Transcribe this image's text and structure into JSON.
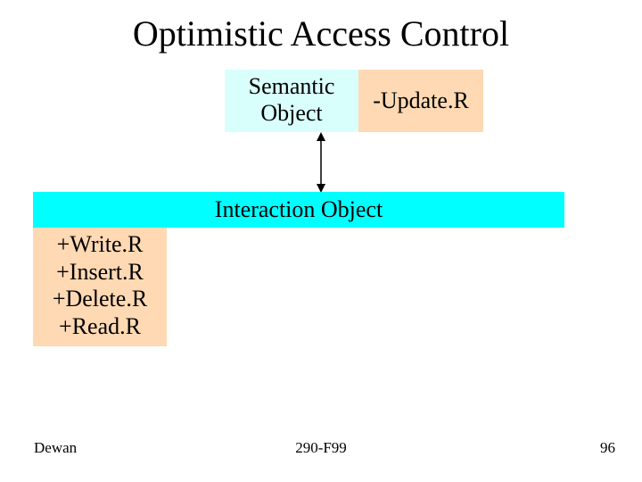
{
  "title": "Optimistic Access Control",
  "top": {
    "semantic_label_line1": "Semantic",
    "semantic_label_line2": "Object",
    "minus_label": "-Update.R"
  },
  "interaction_label": "Interaction Object",
  "plus": {
    "l1": "+Write.R",
    "l2": "+Insert.R",
    "l3": "+Delete.R",
    "l4": "+Read.R"
  },
  "footer": {
    "author": "Dewan",
    "course": "290-F99",
    "page": "96"
  }
}
